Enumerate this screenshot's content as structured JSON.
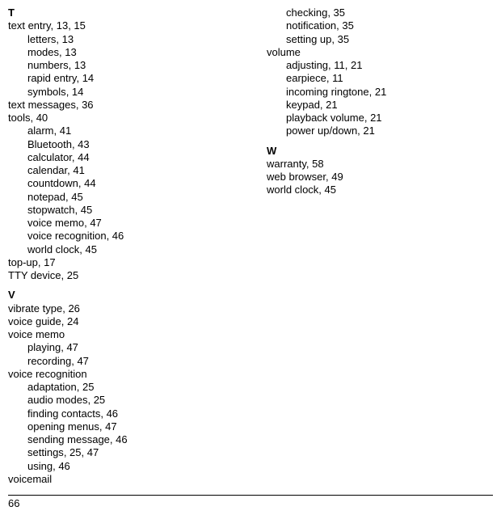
{
  "page_number": "66",
  "left": {
    "sections": [
      {
        "letter": "T",
        "entries": [
          {
            "term": "text entry",
            "pages": "13, 15",
            "subs": [
              {
                "term": "letters",
                "pages": "13"
              },
              {
                "term": "modes",
                "pages": "13"
              },
              {
                "term": "numbers",
                "pages": "13"
              },
              {
                "term": "rapid entry",
                "pages": "14"
              },
              {
                "term": "symbols",
                "pages": "14"
              }
            ]
          },
          {
            "term": "text messages",
            "pages": "36",
            "subs": []
          },
          {
            "term": "tools",
            "pages": "40",
            "subs": [
              {
                "term": "alarm",
                "pages": "41"
              },
              {
                "term": "Bluetooth",
                "pages": "43"
              },
              {
                "term": "calculator",
                "pages": "44"
              },
              {
                "term": "calendar",
                "pages": "41"
              },
              {
                "term": "countdown",
                "pages": "44"
              },
              {
                "term": "notepad",
                "pages": "45"
              },
              {
                "term": "stopwatch",
                "pages": "45"
              },
              {
                "term": "voice memo",
                "pages": "47"
              },
              {
                "term": "voice recognition",
                "pages": "46"
              },
              {
                "term": "world clock",
                "pages": "45"
              }
            ]
          },
          {
            "term": "top-up",
            "pages": "17",
            "subs": []
          },
          {
            "term": "TTY device",
            "pages": "25",
            "subs": []
          }
        ]
      },
      {
        "letter": "V",
        "entries": [
          {
            "term": "vibrate type",
            "pages": "26",
            "subs": []
          },
          {
            "term": "voice guide",
            "pages": "24",
            "subs": []
          },
          {
            "term": "voice memo",
            "pages": "",
            "subs": [
              {
                "term": "playing",
                "pages": "47"
              },
              {
                "term": "recording",
                "pages": "47"
              }
            ]
          },
          {
            "term": "voice recognition",
            "pages": "",
            "subs": [
              {
                "term": "adaptation",
                "pages": "25"
              },
              {
                "term": "audio modes",
                "pages": "25"
              },
              {
                "term": "finding contacts",
                "pages": "46"
              },
              {
                "term": "opening menus",
                "pages": "47"
              },
              {
                "term": "sending message",
                "pages": "46"
              },
              {
                "term": "settings",
                "pages": "25, 47"
              },
              {
                "term": "using",
                "pages": "46"
              }
            ]
          },
          {
            "term": "voicemail",
            "pages": "",
            "subs": []
          }
        ]
      }
    ]
  },
  "right": {
    "continuation_subs": [
      {
        "term": "checking",
        "pages": "35"
      },
      {
        "term": "notification",
        "pages": "35"
      },
      {
        "term": "setting up",
        "pages": "35"
      }
    ],
    "continuation_entry": {
      "term": "volume",
      "pages": "",
      "subs": [
        {
          "term": "adjusting",
          "pages": "11, 21"
        },
        {
          "term": "earpiece",
          "pages": "11"
        },
        {
          "term": "incoming ringtone",
          "pages": "21"
        },
        {
          "term": "keypad",
          "pages": "21"
        },
        {
          "term": "playback volume",
          "pages": "21"
        },
        {
          "term": "power up/down",
          "pages": "21"
        }
      ]
    },
    "sections": [
      {
        "letter": "W",
        "entries": [
          {
            "term": "warranty",
            "pages": "58",
            "subs": []
          },
          {
            "term": "web browser",
            "pages": "49",
            "subs": []
          },
          {
            "term": "world clock",
            "pages": "45",
            "subs": []
          }
        ]
      }
    ]
  }
}
